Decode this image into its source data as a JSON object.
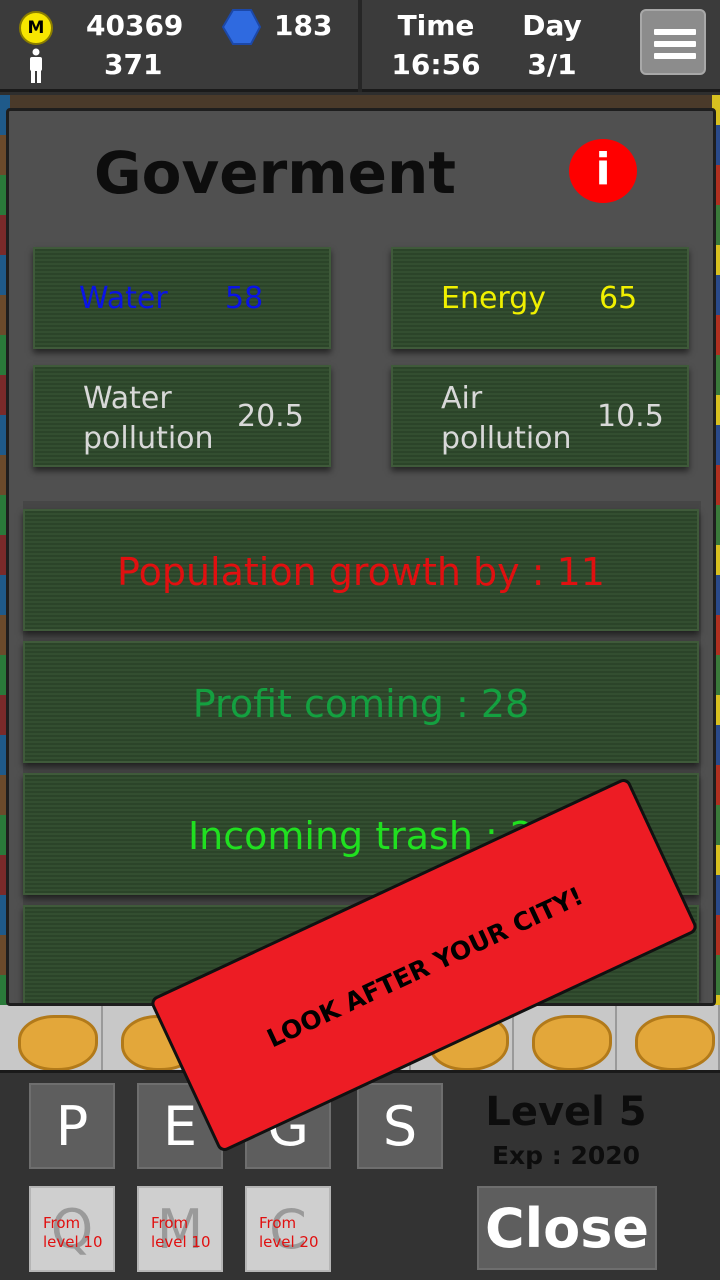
{
  "topbar": {
    "coin_symbol": "M",
    "money": "40369",
    "population": "371",
    "gems": "183",
    "time_label": "Time",
    "time_value": "16:56",
    "day_label": "Day",
    "day_value": "3/1",
    "icons": [
      "coin-icon",
      "person-icon",
      "gem-icon",
      "menu-icon"
    ]
  },
  "panel": {
    "title": "Goverment",
    "info_symbol": "i",
    "stats": {
      "water_label": "Water",
      "water_value": "58",
      "energy_label": "Energy",
      "energy_value": "65",
      "water_pollution_line1": "Water",
      "water_pollution_line2": "pollution",
      "water_pollution_value": "20.5",
      "air_pollution_line1": "Air",
      "air_pollution_line2": "pollution",
      "air_pollution_value": "10.5"
    },
    "rows": {
      "population": "Population growth by : 11",
      "profit": "Profit coming : 28",
      "trash": "Incoming trash : 2"
    },
    "colors": {
      "water": "#0a14e6",
      "energy": "#f0f000",
      "population": "#e01010",
      "profit": "#14a040",
      "trash": "#20e020"
    }
  },
  "bottom": {
    "keys": [
      "P",
      "E",
      "G",
      "S"
    ],
    "locked_keys": [
      {
        "letter": "Q",
        "from_line1": "From",
        "from_line2": "level 10"
      },
      {
        "letter": "M",
        "from_line1": "From",
        "from_line2": "level 10"
      },
      {
        "letter": "C",
        "from_line1": "From",
        "from_line2": "level 20"
      }
    ],
    "level": "Level 5",
    "exp": "Exp : 2020",
    "close_label": "Close"
  },
  "banner": {
    "text": "LOOK AFTER YOUR CITY!"
  }
}
